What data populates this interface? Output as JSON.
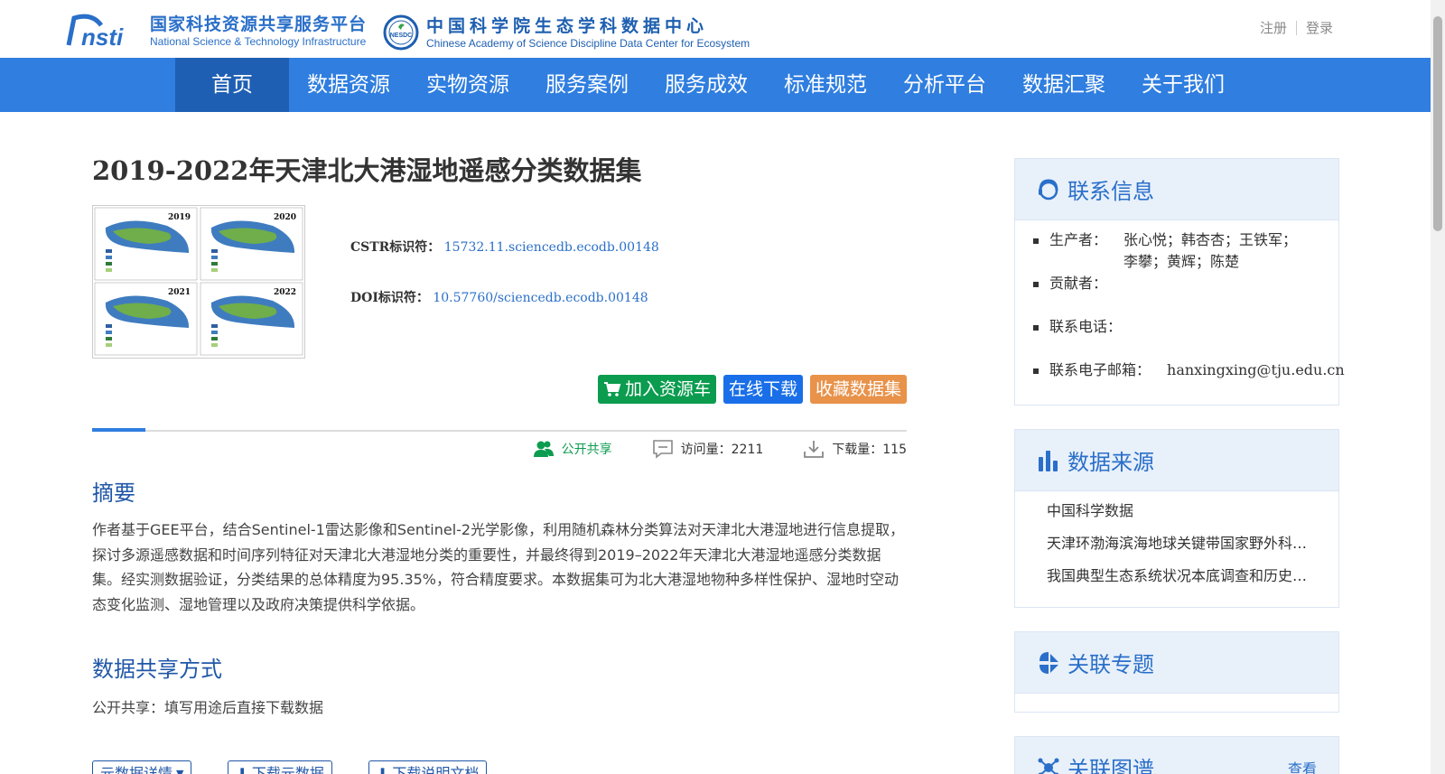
{
  "header": {
    "nsti_cn": "国家科技资源共享服务平台",
    "nsti_en": "National Science & Technology Infrastructure",
    "nsti_logo_text": "nsti",
    "nesdc_cn": "中国科学院生态学科数据中心",
    "nesdc_en": "Chinese Academy of Science Discipline Data Center for Ecosystem",
    "nesdc_logo_text": "NESDC",
    "register": "注册",
    "login": "登录"
  },
  "nav": {
    "items": [
      "首页",
      "数据资源",
      "实物资源",
      "服务案例",
      "服务成效",
      "标准规范",
      "分析平台",
      "数据汇聚",
      "关于我们"
    ],
    "active_index": 0
  },
  "dataset": {
    "title": "2019-2022年天津北大港湿地遥感分类数据集",
    "thumbnail_years": [
      "2019",
      "2020",
      "2021",
      "2022"
    ],
    "cstr_label": "CSTR标识符：",
    "cstr_value": "15732.11.sciencedb.ecodb.00148",
    "doi_label": "DOI标识符：",
    "doi_value": "10.57760/sciencedb.ecodb.00148",
    "btn_cart": "加入资源车",
    "btn_download": "在线下载",
    "btn_favorite": "收藏数据集",
    "share_status": "公开共享",
    "visits": "访问量：2211",
    "downloads": "下载量：115",
    "abstract_title": "摘要",
    "abstract": "作者基于GEE平台，结合Sentinel-1雷达影像和Sentinel-2光学影像，利用随机森林分类算法对天津北大港湿地进行信息提取，探讨多源遥感数据和时间序列特征对天津北大港湿地分类的重要性，并最终得到2019–2022年天津北大港湿地遥感分类数据集。经实测数据验证，分类结果的总体精度为95.35%，符合精度要求。本数据集可为北大港湿地物种多样性保护、湿地时空动态变化监测、湿地管理以及政府决策提供科学依据。",
    "share_title": "数据共享方式",
    "share_method": "公开共享：填写用途后直接下载数据",
    "btn_meta": "元数据详情",
    "btn_meta_download": "下载元数据",
    "btn_doc_download": "下载说明文档"
  },
  "sidebar": {
    "contact": {
      "title": "联系信息",
      "producer_label": "生产者：",
      "producer_value": "张心悦；韩杏杏；王铁军；李攀；黄辉；陈楚",
      "contributor_label": "贡献者：",
      "phone_label": "联系电话：",
      "email_label": "联系电子邮箱：",
      "email_value": "hanxingxing@tju.edu.cn"
    },
    "source": {
      "title": "数据来源",
      "items": [
        "中国科学数据",
        "天津环渤海滨海地球关键带国家野外科学观测研究站",
        "我国典型生态系统状况本底调查和历史数据整编"
      ]
    },
    "topic": {
      "title": "关联专题"
    },
    "graph": {
      "title": "关联图谱",
      "more": "查看"
    }
  },
  "colors": {
    "nav_bg": "#2f7ee0",
    "nav_active": "#1f5fb3",
    "link": "#2a6fc9",
    "green": "#0b9c4f",
    "blue_btn": "#1a6fe8",
    "orange": "#e8924a"
  }
}
